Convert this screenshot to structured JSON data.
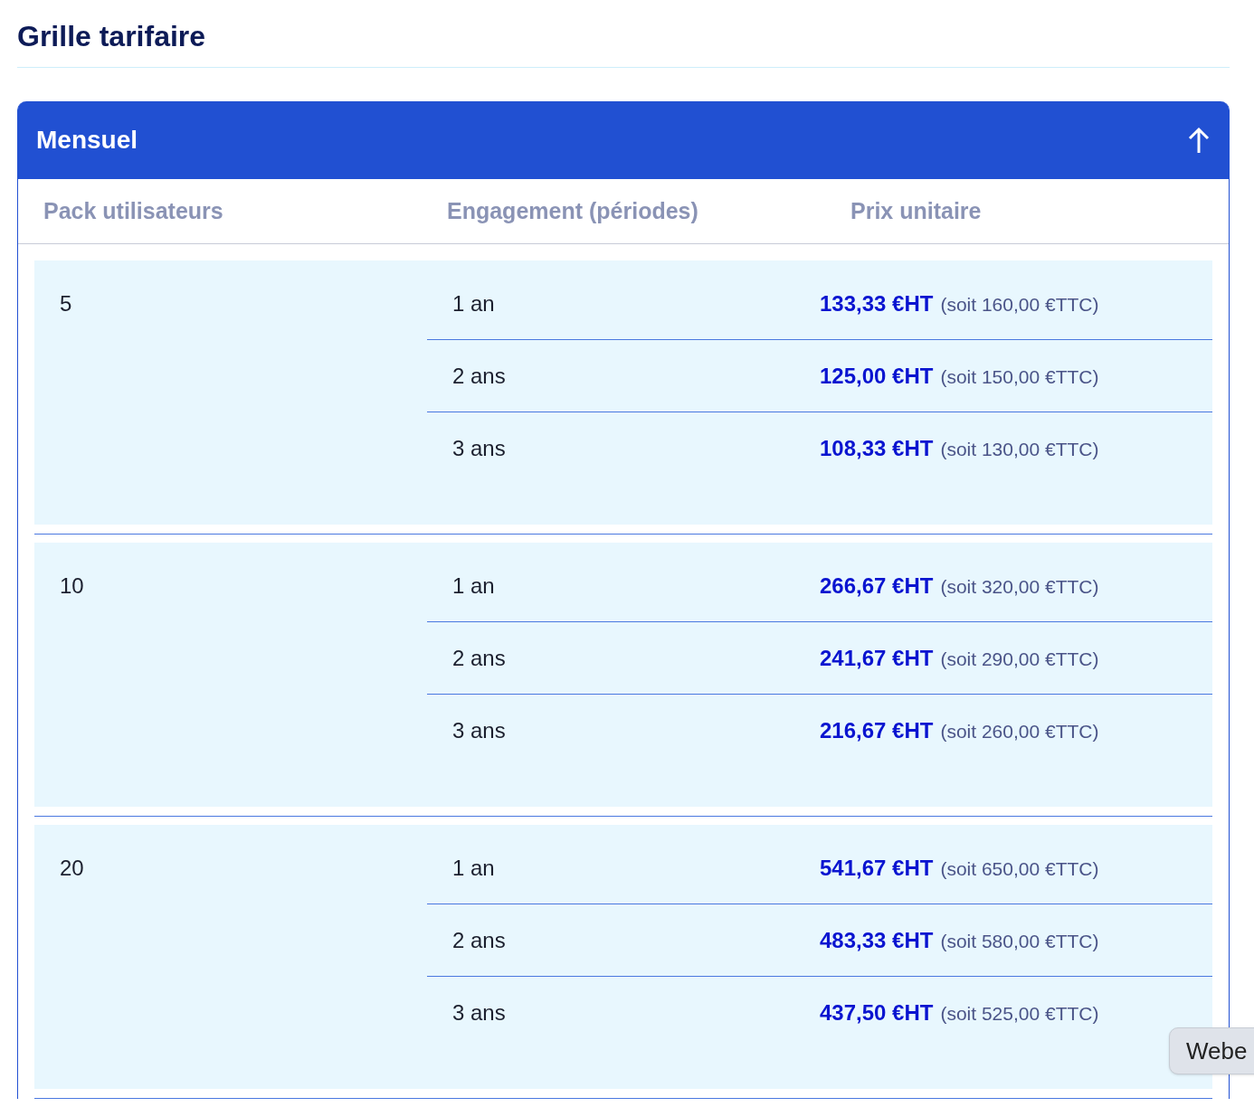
{
  "title": "Grille tarifaire",
  "panel": {
    "title": "Mensuel",
    "expanded": true,
    "columns": [
      "Pack utilisateurs",
      "Engagement (périodes)",
      "Prix unitaire"
    ],
    "groups": [
      {
        "pack": "5",
        "rows": [
          {
            "period": "1 an",
            "price_ht": "133,33 €HT",
            "price_ttc": "(soit 160,00 €TTC)"
          },
          {
            "period": "2 ans",
            "price_ht": "125,00 €HT",
            "price_ttc": "(soit 150,00 €TTC)"
          },
          {
            "period": "3 ans",
            "price_ht": "108,33 €HT",
            "price_ttc": "(soit 130,00 €TTC)"
          }
        ]
      },
      {
        "pack": "10",
        "rows": [
          {
            "period": "1 an",
            "price_ht": "266,67 €HT",
            "price_ttc": "(soit 320,00 €TTC)"
          },
          {
            "period": "2 ans",
            "price_ht": "241,67 €HT",
            "price_ttc": "(soit 290,00 €TTC)"
          },
          {
            "period": "3 ans",
            "price_ht": "216,67 €HT",
            "price_ttc": "(soit 260,00 €TTC)"
          }
        ]
      },
      {
        "pack": "20",
        "rows": [
          {
            "period": "1 an",
            "price_ht": "541,67 €HT",
            "price_ttc": "(soit 650,00 €TTC)"
          },
          {
            "period": "2 ans",
            "price_ht": "483,33 €HT",
            "price_ttc": "(soit 580,00 €TTC)"
          },
          {
            "period": "3 ans",
            "price_ht": "437,50 €HT",
            "price_ttc": "(soit 525,00 €TTC)"
          }
        ]
      }
    ]
  },
  "tooltip": {
    "text": "Webe"
  }
}
